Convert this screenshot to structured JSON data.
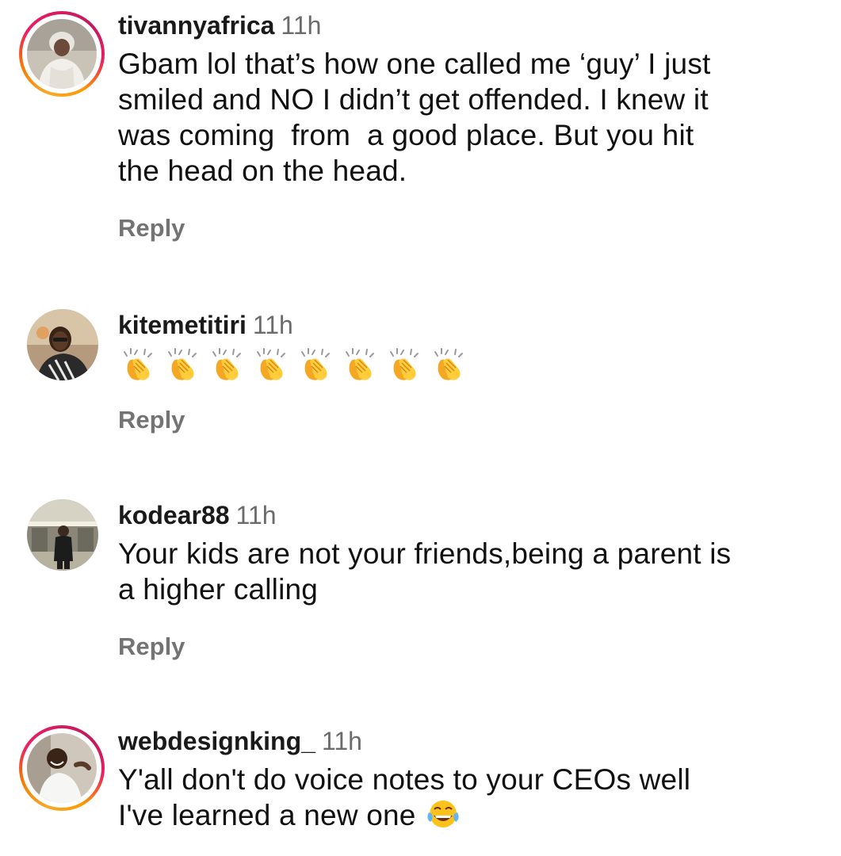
{
  "comments": [
    {
      "username": "tivannyafrica",
      "time": "11h",
      "text": "Gbam lol that’s how one called me ‘guy’ I just\nsmiled and NO I didn’t get offended. I knew it\nwas coming  from  a good place. But you hit\nthe head on the head.",
      "reply_label": "Reply",
      "avatar": "avatar-photo-woman-white-dress",
      "has_story_ring": true
    },
    {
      "username": "kitemetitiri",
      "time": "11h",
      "emoji": "clapping-hands",
      "emoji_count": 8,
      "reply_label": "Reply",
      "avatar": "avatar-photo-woman-glasses",
      "has_story_ring": false
    },
    {
      "username": "kodear88",
      "time": "11h",
      "text": "Your kids are not your friends,being a parent is\na higher calling",
      "reply_label": "Reply",
      "avatar": "avatar-photo-man-lobby",
      "has_story_ring": false
    },
    {
      "username": "webdesignking_",
      "time": "11h",
      "text_line1": "Y'all don't do voice notes to your CEOs well",
      "text_line2": "I've learned a new one",
      "trailing_emoji": "face-with-tears-of-joy",
      "avatar": "avatar-photo-man-laughing",
      "has_story_ring": true
    }
  ],
  "colors": {
    "story_ring_start": "#f9a825",
    "story_ring_end": "#d81b60",
    "meta_gray": "#6b6b6b",
    "reply_gray": "#737373"
  }
}
